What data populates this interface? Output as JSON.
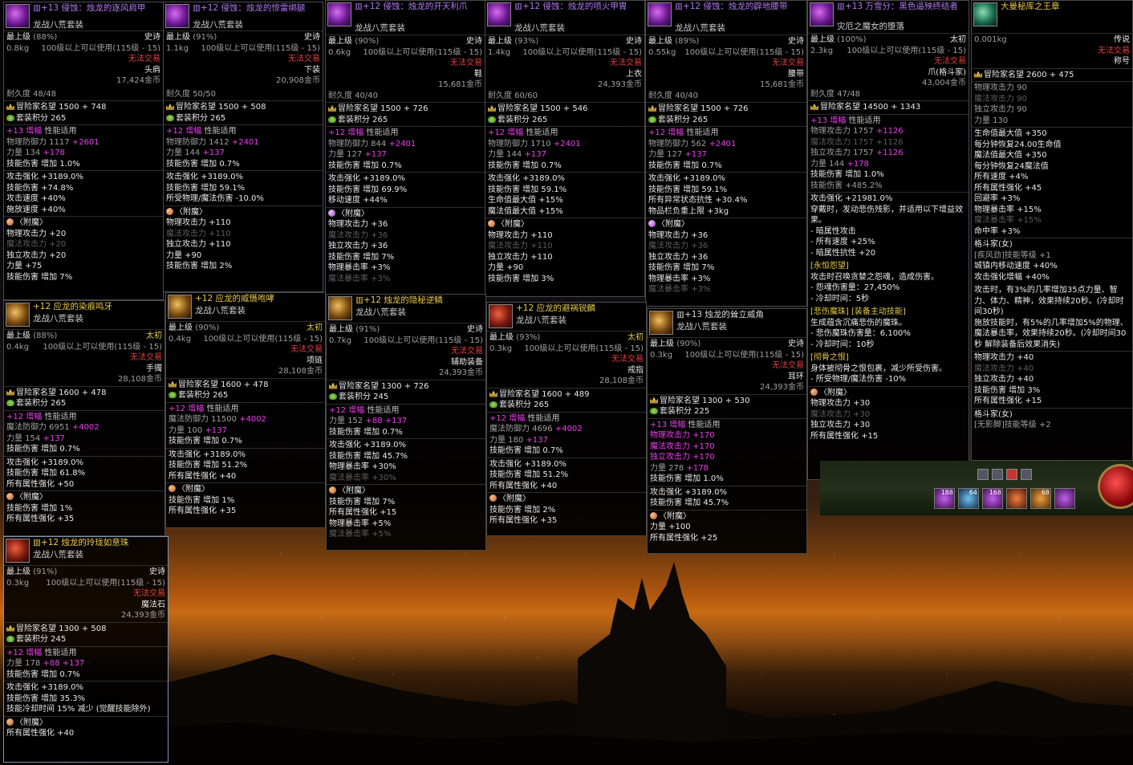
{
  "ui": {
    "top_level": "最上级",
    "untradeable": "无法交易",
    "renown": "冒险家名望",
    "set_points": "套装积分",
    "amplify": "增幅",
    "perf": "性能适用",
    "enchant": "〈附魔〉",
    "durability": "耐久度",
    "set_name": "龙战八荒套装"
  },
  "p1": {
    "name": "▥+13 侵蚀：烛龙的逐风肩甲",
    "set": "龙战八荒套装",
    "pct": "(88%)",
    "rarity": "史诗",
    "weight": "0.8kg",
    "req": "100级以上可以使用(115级 - 15)",
    "trade": "无法交易",
    "slot": "头肩",
    "price": "17,424金币",
    "dur": "耐久度 48/48",
    "renown": "冒险家名望 1500 + 748",
    "setpts": "套装积分 265",
    "amp": "+13",
    "def": "物理防御力 1117",
    "defp": "+2601",
    "str": "力量 134",
    "strp": "+178",
    "skill": "技能伤害 增加 1.0%",
    "o1": "攻击强化 +3189.0%",
    "o2": "技能伤害 +74.8%",
    "o3": "攻击速度 +40%",
    "o4": "施放速度 +40%",
    "e1": "物理攻击力 +20",
    "e2": "魔法攻击力 +20",
    "e3": "独立攻击力 +20",
    "e4": "力量 +75",
    "e5": "技能伤害 增加 7%"
  },
  "p2": {
    "name": "▥+12 侵蚀：烛龙的惊雷绑腿",
    "set": "龙战八荒套装",
    "pct": "(91%)",
    "rarity": "史诗",
    "weight": "1.1kg",
    "req": "100级以上可以使用(115级 - 15)",
    "trade": "无法交易",
    "slot": "下装",
    "price": "20,908金币",
    "dur": "耐久度 50/50",
    "renown": "冒险家名望 1500 + 508",
    "setpts": "套装积分 265",
    "amp": "+12",
    "def": "物理防御力 1412",
    "defp": "+2401",
    "str": "力量 144",
    "strp": "+137",
    "skill": "技能伤害 增加 0.7%",
    "o1": "攻击强化 +3189.0%",
    "o2": "技能伤害 增加 59.1%",
    "o3": "所受物理/魔法伤害 -10.0%",
    "e1": "物理攻击力 +110",
    "e2": "魔法攻击力 +110",
    "e3": "独立攻击力 +110",
    "e4": "力量 +90",
    "e5": "技能伤害 增加 2%"
  },
  "p3": {
    "name": "▥+12 侵蚀：烛龙的开天利爪",
    "set": "龙战八荒套装",
    "pct": "(90%)",
    "rarity": "史诗",
    "weight": "0.6kg",
    "req": "100级以上可以使用(115级 - 15)",
    "trade": "无法交易",
    "slot": "鞋",
    "price": "15,681金币",
    "dur": "耐久度 40/40",
    "renown": "冒险家名望 1500 + 726",
    "setpts": "套装积分 265",
    "amp": "+12",
    "def": "物理防御力 844",
    "defp": "+2401",
    "str": "力量 127",
    "strp": "+137",
    "skill": "技能伤害 增加 0.7%",
    "o1": "攻击强化 +3189.0%",
    "o2": "技能伤害 增加 69.9%",
    "o3": "移动速度 +44%",
    "e1": "物理攻击力 +36",
    "e2": "魔法攻击力 +36",
    "e3": "独立攻击力 +36",
    "e4": "技能伤害 增加 7%",
    "e5": "物理暴击率 +3%",
    "e6": "魔法暴击率 +3%"
  },
  "p4": {
    "name": "▥+12 侵蚀：烛龙的喷火甲胄",
    "set": "龙战八荒套装",
    "pct": "(93%)",
    "rarity": "史诗",
    "weight": "1.4kg",
    "req": "100级以上可以使用(115级 - 15)",
    "trade": "无法交易",
    "slot": "上衣",
    "price": "24,393金币",
    "dur": "耐久度 60/60",
    "renown": "冒险家名望 1500 + 546",
    "setpts": "套装积分 265",
    "amp": "+12",
    "def": "物理防御力 1710",
    "defp": "+2401",
    "str": "力量 144",
    "strp": "+137",
    "skill": "技能伤害 增加 0.7%",
    "o1": "攻击强化 +3189.0%",
    "o2": "技能伤害 增加 59.1%",
    "o3": "生命值最大值 +15%",
    "o4": "魔法值最大值 +15%",
    "e1": "物理攻击力 +110",
    "e2": "魔法攻击力 +110",
    "e3": "独立攻击力 +110",
    "e4": "力量 +90",
    "e5": "技能伤害 增加 3%"
  },
  "p5": {
    "name": "▥+12 侵蚀：烛龙的辟地腰带",
    "set": "龙战八荒套装",
    "pct": "(89%)",
    "rarity": "史诗",
    "weight": "0.55kg",
    "req": "100级以上可以使用(115级 - 15)",
    "trade": "无法交易",
    "slot": "腰带",
    "price": "15,681金币",
    "dur": "耐久度 40/40",
    "renown": "冒险家名望 1500 + 726",
    "setpts": "套装积分 265",
    "amp": "+12",
    "def": "物理防御力 562",
    "defp": "+2401",
    "str": "力量 127",
    "strp": "+137",
    "skill": "技能伤害 增加 0.7%",
    "o1": "攻击强化 +3189.0%",
    "o2": "技能伤害 增加 59.1%",
    "o3": "所有异常状态抗性 +30.4%",
    "o4": "物品栏负重上限 +3kg",
    "e1": "物理攻击力 +36",
    "e2": "魔法攻击力 +36",
    "e3": "独立攻击力 +36",
    "e4": "技能伤害 增加 7%",
    "e5": "物理暴击率 +3%",
    "e6": "魔法暴击率 +3%"
  },
  "p6": {
    "name": "▥+13 万雪分：黑色逼殃终结者",
    "sub": "灾厄之魔女的堕落",
    "pct": "(100%)",
    "rarity": "太初",
    "weight": "2.3kg",
    "req": "100级以上可以使用(115级 - 15)",
    "trade": "无法交易",
    "slot": "爪(格斗家)",
    "price": "43,004金币",
    "dur": "耐久度 47/48",
    "renown": "冒险家名望 14500 + 1343",
    "amp": "+13",
    "a1": "物理攻击力 1757",
    "a1p": "+1126",
    "a2": "魔法攻击力 1757",
    "a2p": "+1126",
    "a3": "独立攻击力 1757",
    "a3p": "+1126",
    "str": "力量 144",
    "strp": "+178",
    "skill": "技能伤害 增加 1.0%",
    "skill2": "技能伤害 +485.2%",
    "t1": "攻击强化 +21981.0%",
    "t2": "穿戴时，发动悲伤残影，并适用以下增益效果。",
    "t3": "- 暗属性攻击",
    "t4": "- 所有速度 +25%",
    "t5": "- 暗属性抗性 +20",
    "h1": "[永恒怨望]",
    "t6": "攻击时召唤贪婪之怨魂，造成伤害。",
    "t7": "- 怨魂伤害量：27,450%",
    "t8": "- 冷却时间：5秒",
    "h2": "[悲伤魔珠] [装备主动技能]",
    "t9": "生成蕴含沉痛悲伤的魔珠。",
    "t10": "- 悲伤魔珠伤害量：6,100%",
    "t11": "- 冷却时间：10秒",
    "h3": "[彻骨之恨]",
    "t12": "身体被彻骨之恨包裹，减少所受伤害。",
    "t13": "- 所受物理/魔法伤害 -10%",
    "e1": "物理攻击力 +30",
    "e2": "魔法攻击力 +30",
    "e3": "独立攻击力 +30",
    "e4": "所有属性强化 +15"
  },
  "p7": {
    "name": "大曼秘库之王章",
    "weight": "0.001kg",
    "rarity": "传说",
    "trade": "无法交易",
    "slot": "称号",
    "renown": "冒险家名望 2600 + 475",
    "s1": "物理攻击力 90",
    "s2": "魔法攻击力 90",
    "s3": "独立攻击力 90",
    "s4": "力量 130",
    "l1": "生命值最大值 +350",
    "l2": "每分钟恢复24.00生命值",
    "l3": "魔法值最大值 +350",
    "l4": "每分钟恢复24魔法值",
    "l5": "所有速度 +4%",
    "l6": "所有属性强化 +45",
    "l7": "回避率 +3%",
    "l8": "物理暴击率 +15%",
    "l9": "魔法暴击率 +15%",
    "l10": "命中率 +3%",
    "c1": "格斗家(女)",
    "c2": "[疾风劲]技能等级 +1",
    "c3": "城镇内移动速度 +40%",
    "c4": "攻击强化增幅 +40%",
    "c5": "攻击时，有3%的几率增加35点力量、智力、体力、精神，效果持续20秒。(冷却时间30秒)",
    "c6": "施放技能时，有5%的几率增加5%的物理、魔法暴击率，效果持续20秒。(冷却时间30秒 解除装备后效果消失)",
    "e1": "物理攻击力 +40",
    "e2": "魔法攻击力 +40",
    "e3": "独立攻击力 +40",
    "e4": "技能伤害 增加 3%",
    "e5": "所有属性强化 +15",
    "c7": "格斗家(女)",
    "c8": "[无影脚]技能等级 +2"
  },
  "p8": {
    "name": "+12 应龙的染痕鸣牙",
    "set": "龙战八荒套装",
    "pct": "(88%)",
    "rarity": "太初",
    "weight": "0.4kg",
    "req": "100级以上可以使用(115级 - 15)",
    "trade": "无法交易",
    "slot": "手镯",
    "price": "28,108金币",
    "renown": "冒险家名望 1600 + 478",
    "setpts": "套装积分 265",
    "amp": "+12",
    "def": "魔法防御力 6951",
    "defp": "+4002",
    "str": "力量 154",
    "strp": "+137",
    "skill": "技能伤害 增加 0.7%",
    "o1": "攻击强化 +3189.0%",
    "o2": "技能伤害 增加 61.8%",
    "o3": "所有属性强化 +50",
    "e1": "技能伤害 增加 1%",
    "e2": "所有属性强化 +35"
  },
  "p9": {
    "name": "+12 应龙的威慑咆哮",
    "set": "龙战八荒套装",
    "pct": "(90%)",
    "rarity": "太初",
    "weight": "0.4kg",
    "req": "100级以上可以使用(115级 - 15)",
    "trade": "无法交易",
    "slot": "项链",
    "price": "28,108金币",
    "renown": "冒险家名望 1600 + 478",
    "setpts": "套装积分 265",
    "amp": "+12",
    "def": "魔法防御力 11500",
    "defp": "+4002",
    "str": "力量 100",
    "strp": "+137",
    "skill": "技能伤害 增加 0.7%",
    "o1": "攻击强化 +3189.0%",
    "o2": "技能伤害 增加 51.2%",
    "o3": "所有属性强化 +40",
    "e1": "技能伤害 增加 1%",
    "e2": "所有属性强化 +35"
  },
  "p10": {
    "name": "▥+12 烛龙的隐秘逆鳞",
    "set": "龙战八荒套装",
    "pct": "(91%)",
    "rarity": "史诗",
    "weight": "0.7kg",
    "req": "100级以上可以使用(115级 - 15)",
    "trade": "无法交易",
    "slot": "辅助装备",
    "price": "24,393金币",
    "renown": "冒险家名望 1300 + 726",
    "setpts": "套装积分 245",
    "amp": "+12",
    "str": "力量 152",
    "strp": "+88 +137",
    "skill": "技能伤害 增加 0.7%",
    "o1": "攻击强化 +3189.0%",
    "o2": "技能伤害 增加 45.7%",
    "o3": "物理暴击率 +30%",
    "o4": "魔法暴击率 +30%",
    "e1": "技能伤害 增加 7%",
    "e2": "所有属性强化 +15",
    "e3": "物理暴击率 +5%",
    "e4": "魔法暴击率 +5%"
  },
  "p11": {
    "name": "+12 应龙的避祸锐麟",
    "set": "龙战八荒套装",
    "pct": "(93%)",
    "rarity": "太初",
    "weight": "0.3kg",
    "req": "100级以上可以使用(115级 - 15)",
    "trade": "无法交易",
    "slot": "戒指",
    "price": "28,108金币",
    "renown": "冒险家名望 1600 + 489",
    "setpts": "套装积分 265",
    "amp": "+12",
    "def": "魔法防御力 4696",
    "defp": "+4002",
    "str": "力量 180",
    "strp": "+137",
    "skill": "技能伤害 增加 0.7%",
    "o1": "攻击强化 +3189.0%",
    "o2": "技能伤害 增加 51.2%",
    "o3": "所有属性强化 +40",
    "e1": "技能伤害 增加 2%",
    "e2": "所有属性强化 +35"
  },
  "p12": {
    "name": "▥+13 烛龙的耸立威角",
    "set": "龙战八荒套装",
    "pct": "(90%)",
    "rarity": "史诗",
    "weight": "0.3kg",
    "req": "100级以上可以使用(115级 - 15)",
    "trade": "无法交易",
    "slot": "耳环",
    "price": "24,393金币",
    "renown": "冒险家名望 1300 + 530",
    "setpts": "套装积分 225",
    "amp": "+13",
    "a1": "物理攻击力 +170",
    "a2": "魔法攻击力 +170",
    "a3": "独立攻击力 +170",
    "str": "力量 278",
    "strp": "+178",
    "skill": "技能伤害 增加 1.0%",
    "o1": "攻击强化 +3189.0%",
    "o2": "技能伤害 增加 45.7%",
    "e1": "力量 +100",
    "e2": "所有属性强化 +25"
  },
  "p13": {
    "name": "▥+12 烛龙的玲珑如意珠",
    "set": "龙战八荒套装",
    "pct": "(91%)",
    "rarity": "史诗",
    "weight": "0.3kg",
    "req": "100级以上可以使用(115级 - 15)",
    "trade": "无法交易",
    "slot": "魔法石",
    "price": "24,393金币",
    "renown": "冒险家名望 1300 + 508",
    "setpts": "套装积分 245",
    "amp": "+12",
    "str": "力量 178",
    "strp": "+88 +137",
    "skill": "技能伤害 增加 0.7%",
    "o1": "攻击强化 +3189.0%",
    "o2": "技能伤害 增加 35.3%",
    "o3": "技能冷却时间 15% 减少 (觉醒技能除外)",
    "e1": "所有属性强化 +40"
  },
  "hud": {
    "counts": [
      "188",
      "64",
      "168",
      "",
      "68",
      ""
    ]
  }
}
